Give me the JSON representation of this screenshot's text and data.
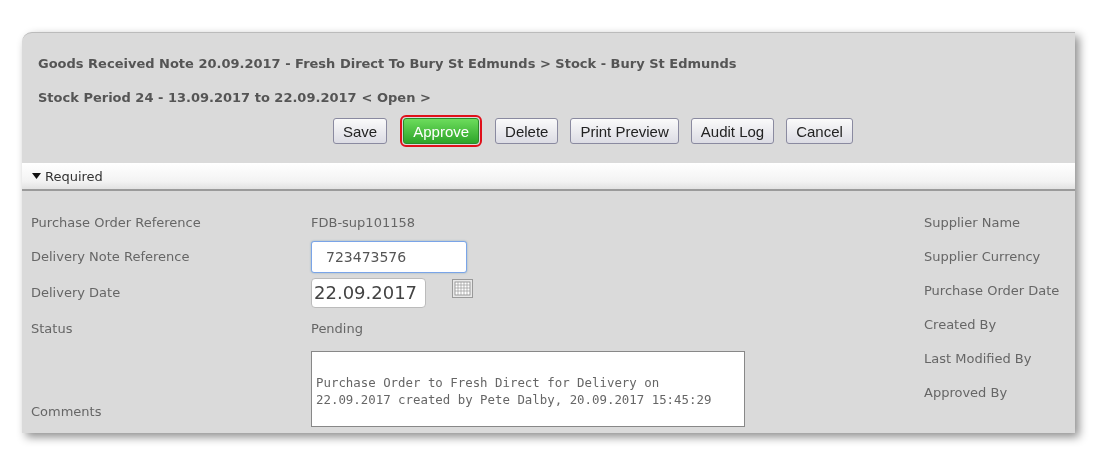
{
  "header": {
    "title": "Goods Received Note 20.09.2017 - Fresh Direct To Bury St Edmunds > Stock - Bury St Edmunds",
    "period": "Stock Period 24 - 13.09.2017 to 22.09.2017",
    "period_status": "< Open >"
  },
  "buttons": [
    {
      "label": "Save",
      "primary": false,
      "highlighted": false
    },
    {
      "label": "Approve",
      "primary": true,
      "highlighted": true
    },
    {
      "label": "Delete",
      "primary": false,
      "highlighted": false
    },
    {
      "label": "Print Preview",
      "primary": false,
      "highlighted": false
    },
    {
      "label": "Audit Log",
      "primary": false,
      "highlighted": false
    },
    {
      "label": "Cancel",
      "primary": false,
      "highlighted": false
    }
  ],
  "section": {
    "title": "Required",
    "expanded": true
  },
  "fields": [
    {
      "kind": "text",
      "label": "Purchase Order Reference",
      "value": "FDB-sup101158"
    },
    {
      "kind": "input",
      "label": "Delivery Note Reference",
      "value": "723473576",
      "focused": true
    },
    {
      "kind": "date",
      "label": "Delivery Date",
      "value": "22.09.2017"
    },
    {
      "kind": "text",
      "label": "Status",
      "value": "Pending"
    },
    {
      "kind": "textarea",
      "label": "Comments",
      "value": "Purchase Order to Fresh Direct for Delivery on\n22.09.2017 created by Pete Dalby, 20.09.2017 15:45:29"
    }
  ],
  "right_labels": [
    "Supplier Name",
    "Supplier Currency",
    "Purchase Order Date",
    "Created By",
    "Last Modified By",
    "Approved By"
  ]
}
